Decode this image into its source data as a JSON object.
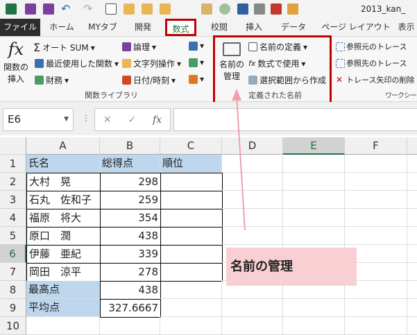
{
  "title": "2013_kan_",
  "colors": {
    "accent": "#217346",
    "highlight": "#c00000",
    "callout": "#f8cfd3",
    "header_fill": "#bdd7ee"
  },
  "tabs": [
    "ファイル",
    "ホーム",
    "MYタブ",
    "開発",
    "数式",
    "校閲",
    "挿入",
    "データ",
    "ページ レイアウト",
    "表示"
  ],
  "active_tab": "数式",
  "ribbon": {
    "insert_function": "関数の挿入",
    "autosum": "オート SUM",
    "recent": "最近使用した関数",
    "financial": "財務",
    "logical": "論理",
    "text": "文字列操作",
    "datetime": "日付/時刻",
    "library_label": "関数ライブラリ",
    "name_manager": "名前の管理",
    "define_name": "名前の定義",
    "use_in_formula": "数式で使用",
    "create_from_selection": "選択範囲から作成",
    "defined_names_label": "定義された名前",
    "trace_precedents": "参照元のトレース",
    "trace_dependents": "参照先のトレース",
    "remove_arrows": "トレース矢印の削除",
    "audit_label": "ワークシー"
  },
  "formula_bar": {
    "name_box": "E6",
    "cancel": "✕",
    "enter": "✓",
    "fx": "fx",
    "value": ""
  },
  "columns": [
    "A",
    "B",
    "C",
    "D",
    "E",
    "F"
  ],
  "rows": [
    "1",
    "2",
    "3",
    "4",
    "5",
    "6",
    "7",
    "8",
    "9",
    "10"
  ],
  "cells": [
    [
      "氏名",
      "総得点",
      "順位"
    ],
    [
      "大村　晃",
      "298",
      ""
    ],
    [
      "石丸　佐和子",
      "259",
      ""
    ],
    [
      "福原　将大",
      "354",
      ""
    ],
    [
      "原口　潤",
      "438",
      ""
    ],
    [
      "伊藤　亜紀",
      "339",
      ""
    ],
    [
      "岡田　涼平",
      "278",
      ""
    ],
    [
      "最高点",
      "438",
      ""
    ],
    [
      "平均点",
      "327.6667",
      ""
    ]
  ],
  "callout": "名前の管理"
}
